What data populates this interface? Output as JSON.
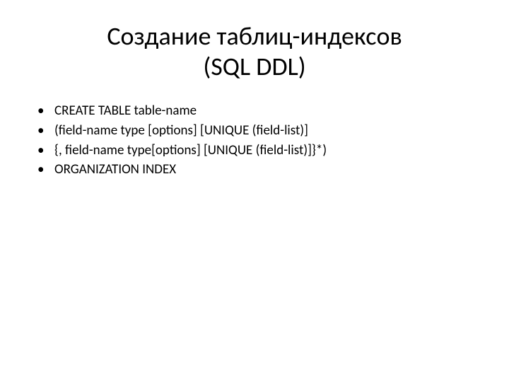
{
  "title_line1": "Создание таблиц-индексов",
  "title_line2": "(SQL DDL)",
  "bullets": {
    "item0": "CREATE TABLE table-name",
    "item1": "(field-name type [options] [UNIQUE (field-list)]",
    "item2": "{, field-name type[options] [UNIQUE (field-list)]}*)",
    "item3": "ORGANIZATION INDEX"
  },
  "bullet_char": "•"
}
